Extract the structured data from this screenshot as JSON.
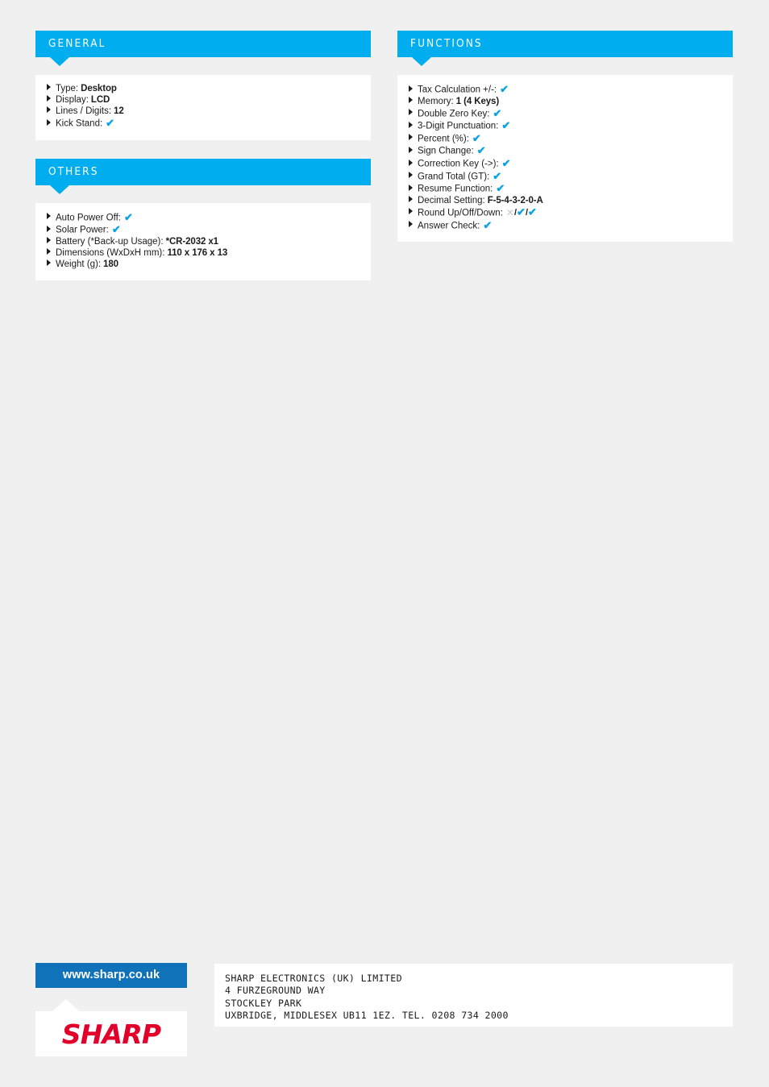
{
  "page": {
    "background_color": "#f0f0f0",
    "accent_color": "#00aeef",
    "check_color": "#0aa3e2",
    "cross_color": "#c9c9c9",
    "brand_red": "#e2002a",
    "web_badge_blue": "#1072b8"
  },
  "sections": {
    "general": {
      "title": "GENERAL",
      "rows": [
        {
          "label": "Type:",
          "value": "Desktop",
          "mark": null
        },
        {
          "label": "Display:",
          "value": "LCD",
          "mark": null
        },
        {
          "label": "Lines / Digits:",
          "value": "12",
          "mark": null
        },
        {
          "label": "Kick Stand:",
          "value": null,
          "mark": "check"
        }
      ]
    },
    "others": {
      "title": "OTHERS",
      "rows": [
        {
          "label": "Auto Power Off:",
          "value": null,
          "mark": "check"
        },
        {
          "label": "Solar Power:",
          "value": null,
          "mark": "check"
        },
        {
          "label": "Battery (*Back-up Usage):",
          "value": "*CR-2032 x1",
          "mark": null
        },
        {
          "label": "Dimensions (WxDxH mm):",
          "value": "110 x 176 x 13",
          "mark": null
        },
        {
          "label": "Weight (g):",
          "value": "180",
          "mark": null
        }
      ]
    },
    "functions": {
      "title": "FUNCTIONS",
      "rows": [
        {
          "label": "Tax Calculation +/-:",
          "value": null,
          "mark": "check"
        },
        {
          "label": "Memory:",
          "value": "1 (4 Keys)",
          "mark": null
        },
        {
          "label": "Double Zero Key:",
          "value": null,
          "mark": "check"
        },
        {
          "label": "3-Digit Punctuation:",
          "value": null,
          "mark": "check"
        },
        {
          "label": "Percent (%):",
          "value": null,
          "mark": "check"
        },
        {
          "label": "Sign Change:",
          "value": null,
          "mark": "check"
        },
        {
          "label": "Correction Key (->):",
          "value": null,
          "mark": "check"
        },
        {
          "label": "Grand Total (GT):",
          "value": null,
          "mark": "check"
        },
        {
          "label": "Resume Function:",
          "value": null,
          "mark": "check"
        },
        {
          "label": "Decimal Setting:",
          "value": "F-5-4-3-2-0-A",
          "mark": null
        },
        {
          "label": "Round Up/Off/Down:",
          "value": null,
          "mark": "cross-check-check"
        },
        {
          "label": "Answer Check:",
          "value": null,
          "mark": "check"
        }
      ]
    }
  },
  "glyphs": {
    "check": "✔",
    "cross": "✕",
    "slash": "/"
  },
  "footer": {
    "web_badge": "www.sharp.co.uk",
    "logo_text": "SHARP",
    "address_lines": [
      "SHARP ELECTRONICS (UK) LIMITED",
      "4 FURZEGROUND WAY",
      "STOCKLEY PARK",
      "UXBRIDGE, MIDDLESEX UB11 1EZ. TEL. 0208 734 2000"
    ]
  }
}
